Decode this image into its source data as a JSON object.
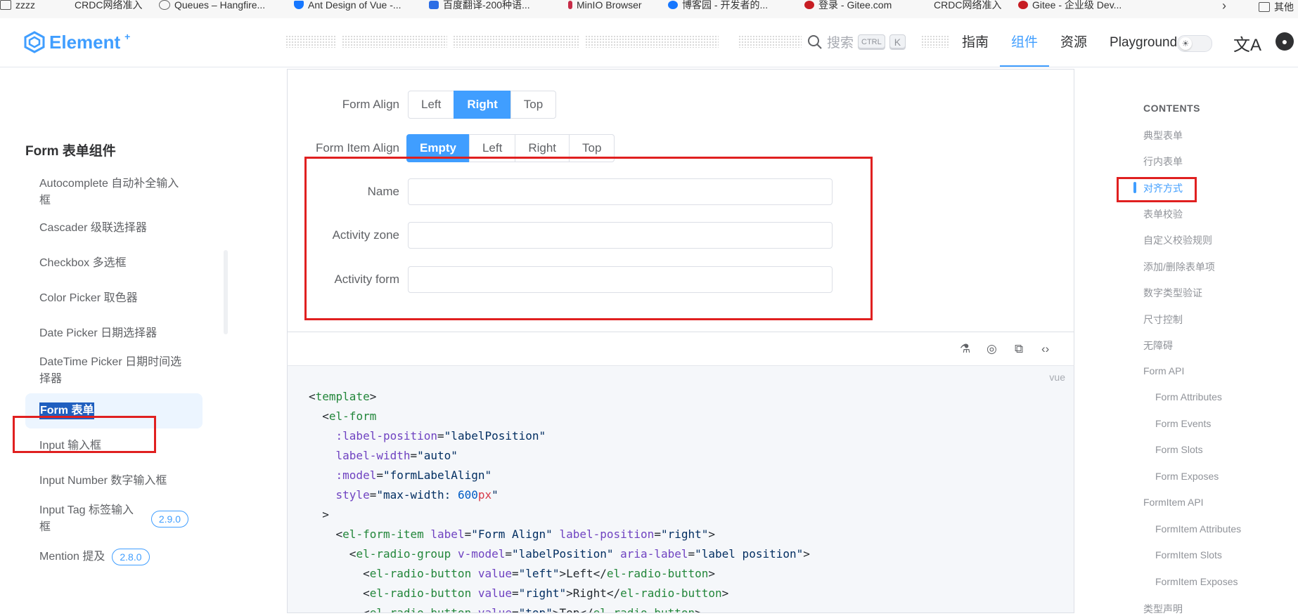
{
  "bookmarks": [
    {
      "label": "zzzz",
      "color": "#555555"
    },
    {
      "label": "CRDC网络准入",
      "color": "#bbbbbb"
    },
    {
      "label": "Queues – Hangfire...",
      "color": "#666666"
    },
    {
      "label": "Ant Design of Vue -...",
      "color": "#1677ff"
    },
    {
      "label": "百度翻译-200种语...",
      "color": "#2b6de5"
    },
    {
      "label": "MinIO Browser",
      "color": "#c72c48"
    },
    {
      "label": "博客园 - 开发者的...",
      "color": "#1677ff"
    },
    {
      "label": "登录 - Gitee.com",
      "color": "#c71d23"
    },
    {
      "label": "CRDC网络准入",
      "color": "#bbbbbb"
    },
    {
      "label": "Gitee - 企业级 Dev...",
      "color": "#c71d23"
    }
  ],
  "bookmarks_overflow": "其他",
  "header": {
    "logo_text": "Element",
    "logo_sup": "+",
    "search_placeholder": "搜索",
    "kbd1": "CTRL",
    "kbd2": "K",
    "nav": [
      {
        "label": "指南",
        "active": false
      },
      {
        "label": "组件",
        "active": true
      },
      {
        "label": "资源",
        "active": false
      },
      {
        "label": "Playground",
        "active": false
      }
    ],
    "lang_icon": "文A"
  },
  "sidebar": {
    "title": "Form 表单组件",
    "items": [
      {
        "label": "Autocomplete 自动补全输入框",
        "badge": ""
      },
      {
        "label": "Cascader 级联选择器",
        "badge": ""
      },
      {
        "label": "Checkbox 多选框",
        "badge": ""
      },
      {
        "label": "Color Picker 取色器",
        "badge": ""
      },
      {
        "label": "Date Picker 日期选择器",
        "badge": ""
      },
      {
        "label": "DateTime Picker 日期时间选择器",
        "badge": ""
      },
      {
        "label": "Form 表单",
        "badge": "",
        "active": true
      },
      {
        "label": "Input 输入框",
        "badge": ""
      },
      {
        "label": "Input Number 数字输入框",
        "badge": ""
      },
      {
        "label": "Input Tag 标签输入框",
        "badge": "2.9.0"
      },
      {
        "label": "Mention 提及",
        "badge": "2.8.0"
      }
    ]
  },
  "demo": {
    "form_align_label": "Form Align",
    "form_align_options": [
      "Left",
      "Right",
      "Top"
    ],
    "form_align_selected": 1,
    "form_item_align_label": "Form Item Align",
    "form_item_align_options": [
      "Empty",
      "Left",
      "Right",
      "Top"
    ],
    "form_item_align_selected": 0,
    "fields": [
      "Name",
      "Activity zone",
      "Activity form"
    ]
  },
  "code": {
    "lang": "vue"
  },
  "toc": {
    "title": "CONTENTS",
    "items": [
      {
        "label": "典型表单",
        "level": 1
      },
      {
        "label": "行内表单",
        "level": 1
      },
      {
        "label": "对齐方式",
        "level": 1,
        "active": true
      },
      {
        "label": "表单校验",
        "level": 1
      },
      {
        "label": "自定义校验规则",
        "level": 1
      },
      {
        "label": "添加/删除表单项",
        "level": 1
      },
      {
        "label": "数字类型验证",
        "level": 1
      },
      {
        "label": "尺寸控制",
        "level": 1
      },
      {
        "label": "无障碍",
        "level": 1
      },
      {
        "label": "Form API",
        "level": 1
      },
      {
        "label": "Form Attributes",
        "level": 2
      },
      {
        "label": "Form Events",
        "level": 2
      },
      {
        "label": "Form Slots",
        "level": 2
      },
      {
        "label": "Form Exposes",
        "level": 2
      },
      {
        "label": "FormItem API",
        "level": 1
      },
      {
        "label": "FormItem Attributes",
        "level": 2
      },
      {
        "label": "FormItem Slots",
        "level": 2
      },
      {
        "label": "FormItem Exposes",
        "level": 2
      },
      {
        "label": "类型声明",
        "level": 1
      }
    ]
  },
  "colors": {
    "accent": "#409eff",
    "highlight_box": "#e02020",
    "active_bg": "#ecf5ff"
  }
}
